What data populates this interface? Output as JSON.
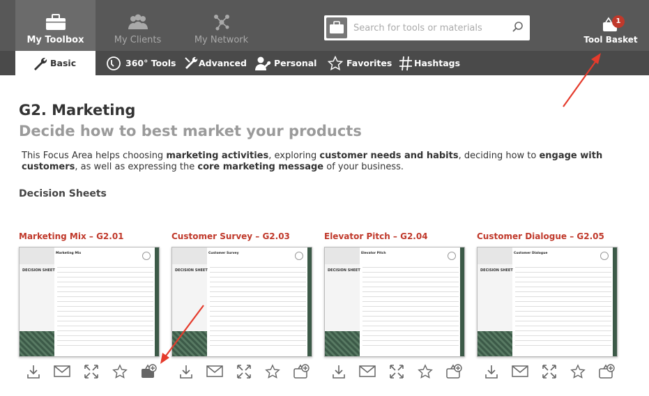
{
  "topnav": [
    {
      "label": "My Toolbox",
      "icon": "briefcase-icon",
      "active": true
    },
    {
      "label": "My Clients",
      "icon": "people-icon",
      "active": false
    },
    {
      "label": "My Network",
      "icon": "network-icon",
      "active": false
    }
  ],
  "search": {
    "placeholder": "Search for tools or materials"
  },
  "basket": {
    "label": "Tool Basket",
    "count": "1"
  },
  "subnav": [
    {
      "label": "Basic",
      "icon": "wrench-icon",
      "active": true
    },
    {
      "label": "360° Tools",
      "icon": "tools-360-icon"
    },
    {
      "label": "Advanced",
      "icon": "advanced-tools-icon"
    },
    {
      "label": "Personal",
      "icon": "personal-tool-icon"
    },
    {
      "label": "Favorites",
      "icon": "star-icon"
    },
    {
      "label": "Hashtags",
      "icon": "hashtag-icon"
    }
  ],
  "page": {
    "title": "G2. Marketing",
    "subtitle": "Decide how to best market your products",
    "desc": {
      "t1": "This Focus Area helps choosing ",
      "b1": "marketing activities",
      "t2": ", exploring ",
      "b2": "customer needs and habits",
      "t3": ", deciding how to ",
      "b3": "engage with customers",
      "t4": ", as well as expressing the ",
      "b4": "core marketing message",
      "t5": " of your business."
    },
    "section": "Decision Sheets"
  },
  "cards": [
    {
      "title": "Marketing Mix – G2.01",
      "sheet_title": "Marketing Mix",
      "sheet_label": "DECISION SHEET"
    },
    {
      "title": "Customer Survey – G2.03",
      "sheet_title": "Customer Survey",
      "sheet_label": "DECISION SHEET"
    },
    {
      "title": "Elevator Pitch – G2.04",
      "sheet_title": "Elevator Pitch",
      "sheet_label": "DECISION SHEET"
    },
    {
      "title": "Customer Dialogue – G2.05",
      "sheet_title": "Customer Dialogue",
      "sheet_label": "DECISION SHEET"
    }
  ],
  "colors": {
    "topbar": "#585858",
    "subbar": "#4a4a4a",
    "accent_red": "#c0392b",
    "annotation_arrow": "#e53b2c"
  }
}
